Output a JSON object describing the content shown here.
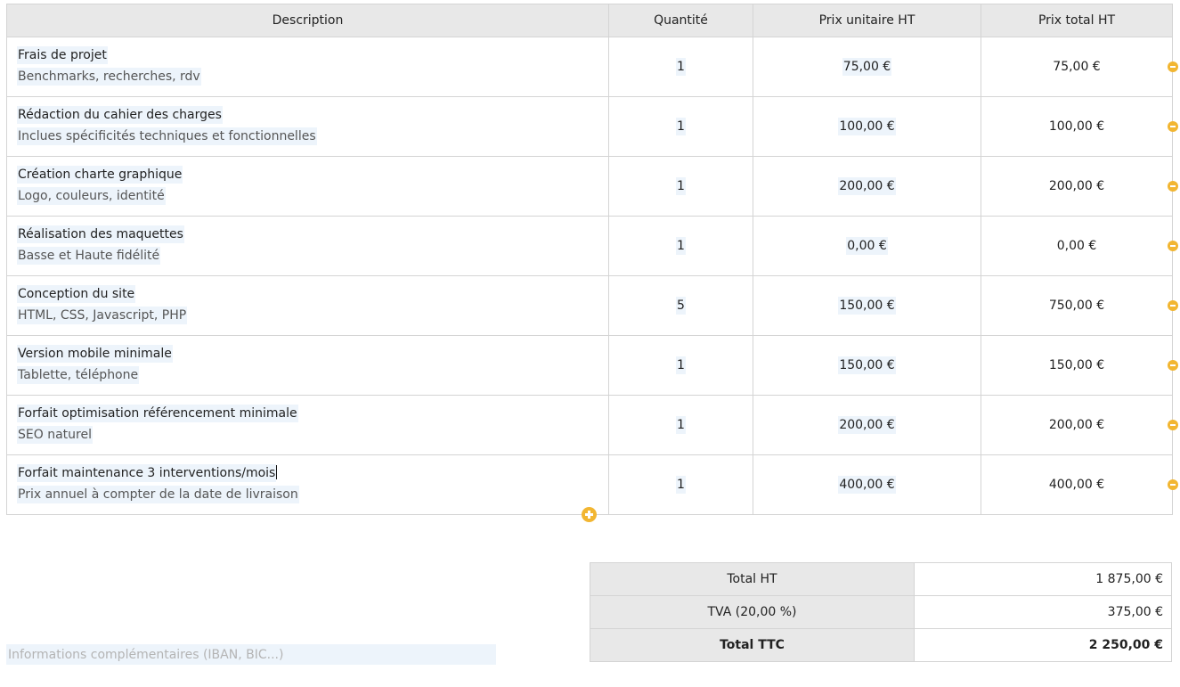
{
  "table": {
    "headers": {
      "description": "Description",
      "quantity": "Quantité",
      "unit_price": "Prix unitaire HT",
      "total_price": "Prix total HT"
    },
    "rows": [
      {
        "title": "Frais de projet",
        "subtitle": "Benchmarks, recherches, rdv",
        "qty": "1",
        "unit_price": "75,00 €",
        "total": "75,00 €"
      },
      {
        "title": "Rédaction du cahier des charges",
        "subtitle": "Inclues spécificités techniques et fonctionnelles",
        "qty": "1",
        "unit_price": "100,00 €",
        "total": "100,00 €"
      },
      {
        "title": "Création charte graphique",
        "subtitle": "Logo, couleurs, identité",
        "qty": "1",
        "unit_price": "200,00 €",
        "total": "200,00 €"
      },
      {
        "title": "Réalisation des maquettes",
        "subtitle": "Basse et Haute fidélité",
        "qty": "1",
        "unit_price": "0,00 €",
        "total": "0,00 €"
      },
      {
        "title": "Conception du site",
        "subtitle": "HTML, CSS, Javascript, PHP",
        "qty": "5",
        "unit_price": "150,00 €",
        "total": "750,00 €"
      },
      {
        "title": "Version mobile minimale",
        "subtitle": "Tablette, téléphone",
        "qty": "1",
        "unit_price": "150,00 €",
        "total": "150,00 €"
      },
      {
        "title": "Forfait optimisation référencement minimale",
        "subtitle": "SEO naturel",
        "qty": "1",
        "unit_price": "200,00 €",
        "total": "200,00 €"
      },
      {
        "title": "Forfait maintenance 3 interventions/mois",
        "subtitle": "Prix annuel à compter de la date de livraison",
        "qty": "1",
        "unit_price": "400,00 €",
        "total": "400,00 €"
      }
    ]
  },
  "totals": {
    "total_ht_label": "Total HT",
    "total_ht_value": "1 875,00 €",
    "tva_label": "TVA (20,00 %)",
    "tva_value": "375,00 €",
    "total_ttc_label": "Total TTC",
    "total_ttc_value": "2 250,00 €"
  },
  "info": {
    "placeholder": "Informations complémentaires (IBAN, BIC...)"
  },
  "colors": {
    "accent": "#f2b632",
    "header_bg": "#e8e8e8",
    "field_highlight": "#edf4fb",
    "border": "#d4d4d4"
  }
}
